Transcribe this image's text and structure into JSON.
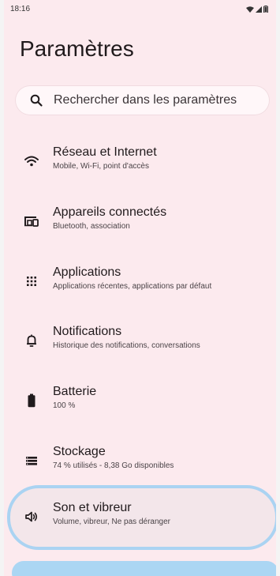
{
  "status_bar": {
    "time": "18:16",
    "icons": [
      "wifi-icon",
      "signal-icon",
      "battery-icon"
    ]
  },
  "page": {
    "title": "Paramètres"
  },
  "search": {
    "label": "Rechercher dans les paramètres",
    "icon": "search-icon"
  },
  "settings": [
    {
      "title": "Réseau et Internet",
      "subtitle": "Mobile, Wi-Fi, point d'accès",
      "icon": "wifi-icon"
    },
    {
      "title": "Appareils connectés",
      "subtitle": "Bluetooth, association",
      "icon": "connected-devices-icon"
    },
    {
      "title": "Applications",
      "subtitle": "Applications récentes, applications par défaut",
      "icon": "apps-grid-icon"
    },
    {
      "title": "Notifications",
      "subtitle": "Historique des notifications, conversations",
      "icon": "bell-icon"
    },
    {
      "title": "Batterie",
      "subtitle": "100 %",
      "icon": "battery-icon"
    },
    {
      "title": "Stockage",
      "subtitle": "74 % utilisés - 8,38 Go disponibles",
      "icon": "storage-icon"
    },
    {
      "title": "Son et vibreur",
      "subtitle": "Volume, vibreur, Ne pas déranger",
      "icon": "speaker-icon"
    }
  ],
  "colors": {
    "background": "#fceaee",
    "highlight": "#aad3f2"
  }
}
